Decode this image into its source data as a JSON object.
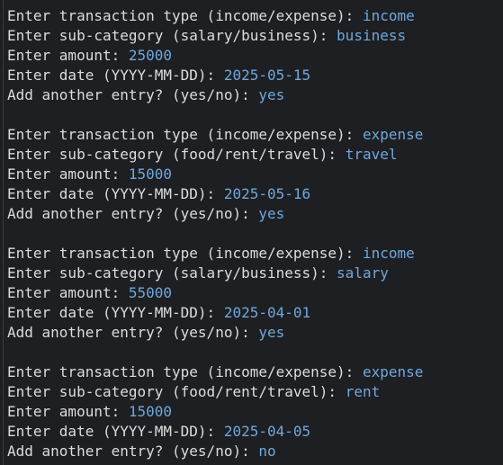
{
  "blocks": [
    {
      "lines": [
        {
          "prompt": "Enter transaction type (income/expense): ",
          "value": "income"
        },
        {
          "prompt": "Enter sub-category (salary/business): ",
          "value": "business"
        },
        {
          "prompt": "Enter amount: ",
          "value": "25000"
        },
        {
          "prompt": "Enter date (YYYY-MM-DD): ",
          "value": "2025-05-15"
        },
        {
          "prompt": "Add another entry? (yes/no): ",
          "value": "yes"
        }
      ]
    },
    {
      "lines": [
        {
          "prompt": "Enter transaction type (income/expense): ",
          "value": "expense"
        },
        {
          "prompt": "Enter sub-category (food/rent/travel): ",
          "value": "travel"
        },
        {
          "prompt": "Enter amount: ",
          "value": "15000"
        },
        {
          "prompt": "Enter date (YYYY-MM-DD): ",
          "value": "2025-05-16"
        },
        {
          "prompt": "Add another entry? (yes/no): ",
          "value": "yes"
        }
      ]
    },
    {
      "lines": [
        {
          "prompt": "Enter transaction type (income/expense): ",
          "value": "income"
        },
        {
          "prompt": "Enter sub-category (salary/business): ",
          "value": "salary"
        },
        {
          "prompt": "Enter amount: ",
          "value": "55000"
        },
        {
          "prompt": "Enter date (YYYY-MM-DD): ",
          "value": "2025-04-01"
        },
        {
          "prompt": "Add another entry? (yes/no): ",
          "value": "yes"
        }
      ]
    },
    {
      "lines": [
        {
          "prompt": "Enter transaction type (income/expense): ",
          "value": "expense"
        },
        {
          "prompt": "Enter sub-category (food/rent/travel): ",
          "value": "rent"
        },
        {
          "prompt": "Enter amount: ",
          "value": "15000"
        },
        {
          "prompt": "Enter date (YYYY-MM-DD): ",
          "value": "2025-04-05"
        },
        {
          "prompt": "Add another entry? (yes/no): ",
          "value": "no"
        }
      ]
    }
  ]
}
